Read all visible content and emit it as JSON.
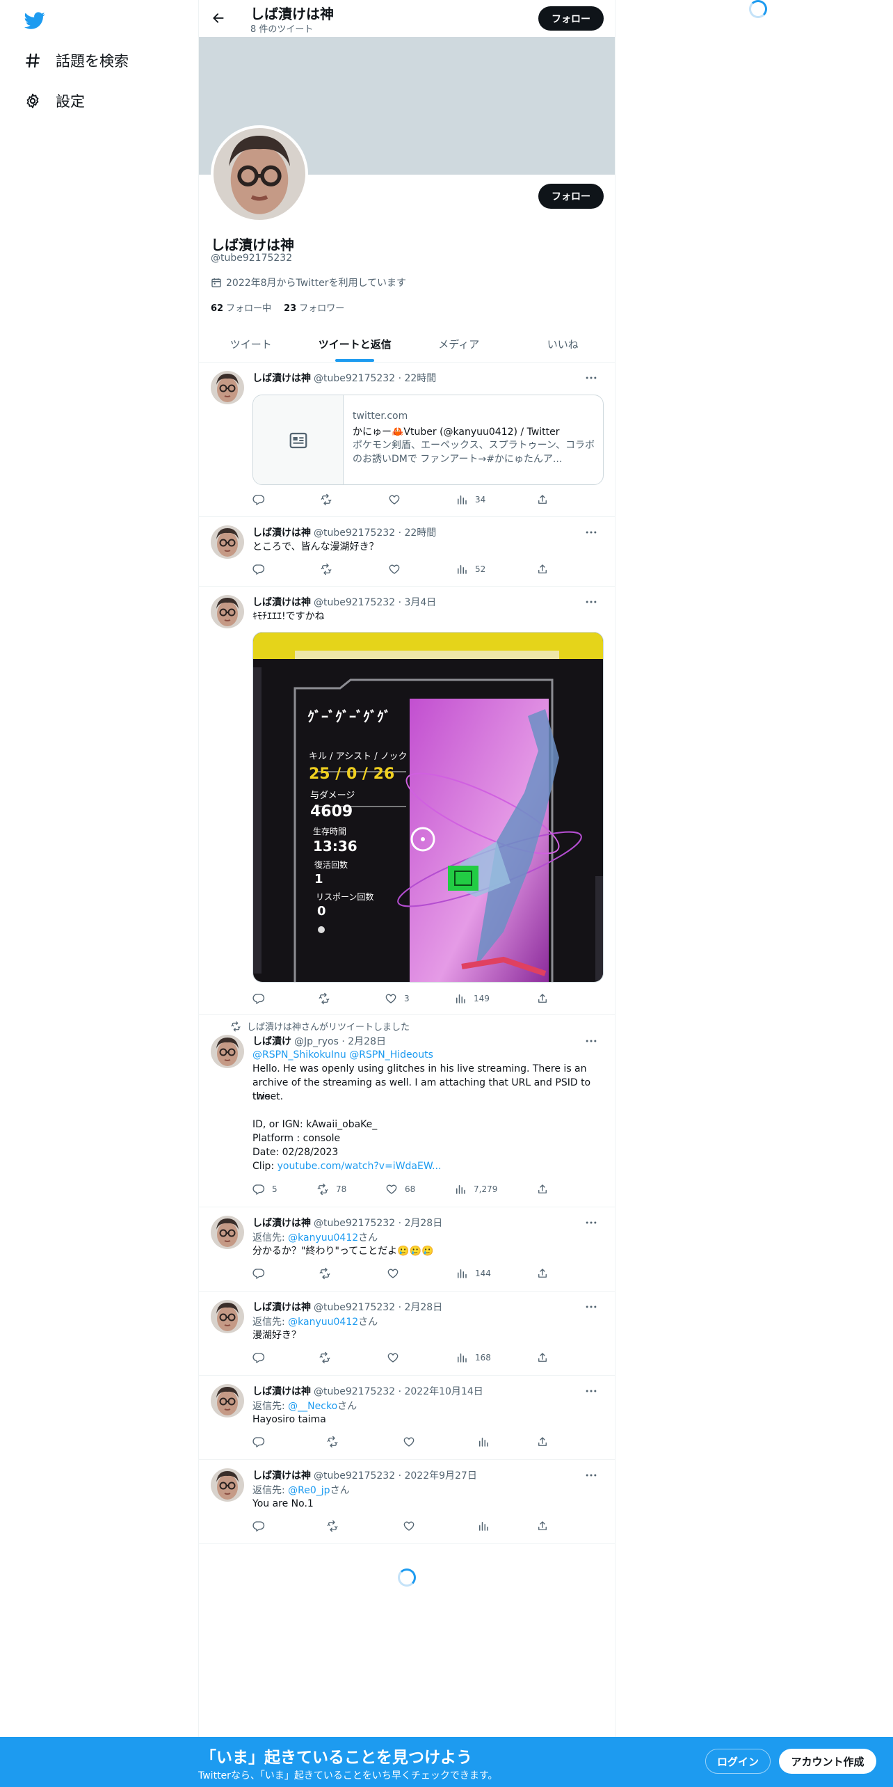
{
  "nav": {
    "logo_icon": "twitter-bird-icon",
    "items": [
      {
        "icon": "hashtag-icon",
        "label": "話題を検索"
      },
      {
        "icon": "gear-icon",
        "label": "設定"
      }
    ]
  },
  "header": {
    "name": "しば漬けは神",
    "tweet_count": "8 件のツイート",
    "follow_label": "フォロー"
  },
  "profile": {
    "name": "しば漬けは神",
    "handle": "@tube92175232",
    "joined": "2022年8月からTwitterを利用しています",
    "following_count": "62",
    "following_label": "フォロー中",
    "followers_count": "23",
    "followers_label": "フォロワー",
    "follow_label": "フォロー"
  },
  "tabs": [
    "ツイート",
    "ツイートと返信",
    "メディア",
    "いいね"
  ],
  "tweets": [
    {
      "name": "しば漬けは神",
      "meta": "@tube92175232 · 22時間",
      "card": {
        "domain": "twitter.com",
        "title": "かにゅー🦀Vtuber (@kanyuu0412) / Twitter",
        "desc": "ポケモン剣盾、エーペックス、スプラトゥーン、コラボのお誘いDMで ファンアート→#かにゅたんア..."
      },
      "stats": {
        "views": "34"
      }
    },
    {
      "name": "しば漬けは神",
      "meta": "@tube92175232 · 22時間",
      "text": "ところで、皆んな漫湖好き？",
      "stats": {
        "views": "52"
      }
    },
    {
      "name": "しば漬けは神",
      "meta": "@tube92175232 · 3月4日",
      "text": "ｷﾓﾁｴｴｴ!ですかね",
      "stats": {
        "likes": "3",
        "views": "149"
      }
    },
    {
      "retweet_note": "しば漬けは神さんがリツイートしました",
      "name": "しば漬け",
      "meta": "@Jp_ryos · 2月28日",
      "mentions": "@RSPN_ShikokuInu @RSPN_Hideouts",
      "text_lines": [
        "Hello. He was openly using glitches in his live streaming. There is an",
        "archive of the streaming as well. I am attaching that URL and PSID to this",
        "tweet.",
        "",
        "ID, or IGN: kAwaii_obaKe_",
        "Platform : console",
        "Date: 02/28/2023"
      ],
      "clip_label": "Clip: ",
      "clip_link": "youtube.com/watch?v=iWdaEW...",
      "stats": {
        "replies": "5",
        "retweets": "78",
        "likes": "68",
        "views": "7,279"
      }
    },
    {
      "name": "しば漬けは神",
      "meta": "@tube92175232 · 2月28日",
      "reply_prefix": "返信先: ",
      "reply_to": "@kanyuu0412",
      "reply_suffix": "さん",
      "text": "分かるか？\"終わり\"ってことだよ🥲🥲🥲",
      "stats": {
        "views": "144"
      }
    },
    {
      "name": "しば漬けは神",
      "meta": "@tube92175232 · 2月28日",
      "reply_prefix": "返信先: ",
      "reply_to": "@kanyuu0412",
      "reply_suffix": "さん",
      "text": "漫湖好き？",
      "stats": {
        "views": "168"
      }
    },
    {
      "name": "しば漬けは神",
      "meta": "@tube92175232 · 2022年10月14日",
      "reply_prefix": "返信先: ",
      "reply_to": "@__Necko",
      "reply_suffix": "さん",
      "text": "Hayosiro taima",
      "stats": {}
    },
    {
      "name": "しば漬けは神",
      "meta": "@tube92175232 · 2022年9月27日",
      "reply_prefix": "返信先: ",
      "reply_to": "@Re0_jp",
      "reply_suffix": "さん",
      "text": "You are No.1",
      "stats": {}
    }
  ],
  "media_overlay": {
    "player": "ｸﾞｰﾞｸﾞｰﾞｸﾞｸﾞ",
    "kill_label": "キル / アシスト / ノック",
    "kill_value": "25 / 0 / 26",
    "damage_label": "与ダメージ",
    "damage_value": "4609",
    "survival_label": "生存時間",
    "survival_value": "13:36",
    "revive_label": "復活回数",
    "revive_value": "1",
    "respawn_label": "リスポーン回数",
    "respawn_value": "0"
  },
  "bottom_bar": {
    "title": "「いま」起きていることを見つけよう",
    "subtitle": "Twitterなら、「いま」起きていることをいち早くチェックできます。",
    "login_label": "ログイン",
    "signup_label": "アカウント作成"
  },
  "colors": {
    "accent": "#1d9bf0",
    "text": "#0f1419",
    "muted": "#536471",
    "banner": "#cfd9de"
  }
}
